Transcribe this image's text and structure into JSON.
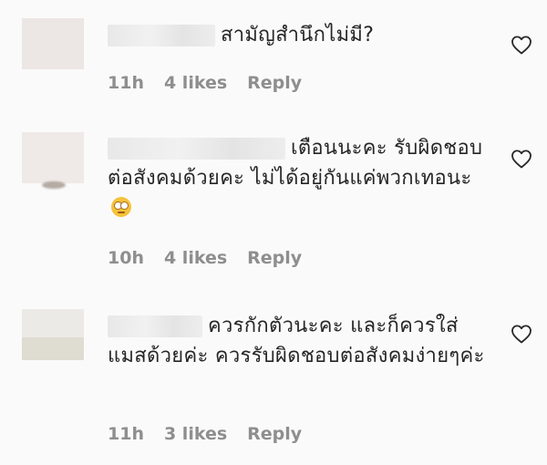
{
  "comments": [
    {
      "text": "สามัญสำนึกไม่มี?",
      "time": "11h",
      "likes": "4 likes",
      "reply": "Reply"
    },
    {
      "text": "เตือนนะคะ รับผิดชอบต่อสังคมด้วยคะ ไม่ได้อยู่กันแค่พวกเทอนะ",
      "emoji": "eye-roll-emoji",
      "time": "10h",
      "likes": "4 likes",
      "reply": "Reply"
    },
    {
      "text": "ควรกักตัวนะคะ และก็ควรใส่แมสด้วยค่ะ ควรรับผิดชอบต่อสังคมง่ายๆค่ะ",
      "time": "11h",
      "likes": "3 likes",
      "reply": "Reply"
    }
  ],
  "icons": {
    "like": "heart-outline-icon",
    "emoji": "face-with-rolling-eyes"
  },
  "colors": {
    "background": "#fafafa",
    "text": "#262626",
    "meta": "#8e8e8e"
  }
}
